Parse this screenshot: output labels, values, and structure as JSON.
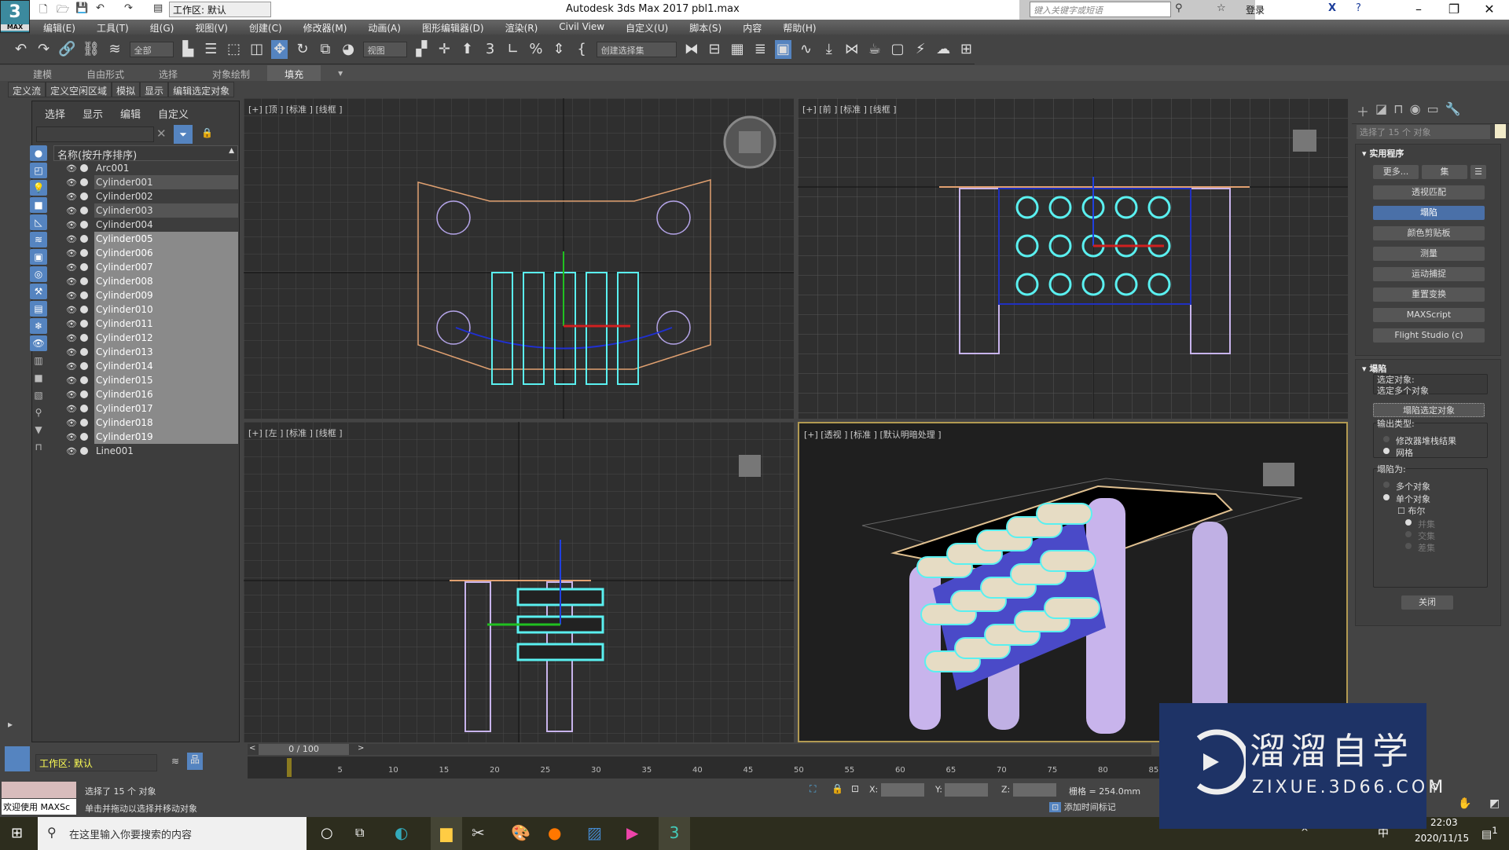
{
  "titlebar": {
    "logo": "3",
    "logo_sub": "MAX",
    "workspace": "工作区: 默认",
    "app_title": "Autodesk 3ds Max 2017",
    "file": "pbl1.max",
    "search_placeholder": "键入关键字或短语",
    "login": "登录"
  },
  "menu": [
    "编辑(E)",
    "工具(T)",
    "组(G)",
    "视图(V)",
    "创建(C)",
    "修改器(M)",
    "动画(A)",
    "图形编辑器(D)",
    "渲染(R)",
    "Civil View",
    "自定义(U)",
    "脚本(S)",
    "内容",
    "帮助(H)"
  ],
  "toolbar": {
    "filter": "全部",
    "ref_coord": "视图",
    "selection_set": "创建选择集"
  },
  "ribbon": {
    "tabs": [
      "建模",
      "自由形式",
      "选择",
      "对象绘制",
      "填充"
    ],
    "active": "填充",
    "subtabs": [
      "定义流",
      "定义空闲区域",
      "模拟",
      "显示",
      "编辑选定对象"
    ]
  },
  "explorer": {
    "menu": [
      "选择",
      "显示",
      "编辑",
      "自定义"
    ],
    "column_header": "名称(按升序排序)",
    "rows": [
      {
        "name": "Arc001",
        "state": "none"
      },
      {
        "name": "Cylinder001",
        "state": "part"
      },
      {
        "name": "Cylinder002",
        "state": "none"
      },
      {
        "name": "Cylinder003",
        "state": "part"
      },
      {
        "name": "Cylinder004",
        "state": "none"
      },
      {
        "name": "Cylinder005",
        "state": "sel"
      },
      {
        "name": "Cylinder006",
        "state": "sel"
      },
      {
        "name": "Cylinder007",
        "state": "sel"
      },
      {
        "name": "Cylinder008",
        "state": "sel"
      },
      {
        "name": "Cylinder009",
        "state": "sel"
      },
      {
        "name": "Cylinder010",
        "state": "sel"
      },
      {
        "name": "Cylinder011",
        "state": "sel"
      },
      {
        "name": "Cylinder012",
        "state": "sel"
      },
      {
        "name": "Cylinder013",
        "state": "sel"
      },
      {
        "name": "Cylinder014",
        "state": "sel"
      },
      {
        "name": "Cylinder015",
        "state": "sel"
      },
      {
        "name": "Cylinder016",
        "state": "sel"
      },
      {
        "name": "Cylinder017",
        "state": "sel"
      },
      {
        "name": "Cylinder018",
        "state": "sel"
      },
      {
        "name": "Cylinder019",
        "state": "sel"
      },
      {
        "name": "Line001",
        "state": "none"
      }
    ],
    "workspace": "工作区: 默认"
  },
  "viewports": {
    "top": "[+] [顶 ] [标准 ] [线框 ]",
    "front": "[+] [前 ] [标准 ] [线框 ]",
    "left": "[+] [左 ] [标准 ] [线框 ]",
    "persp": "[+] [透视 ] [标准 ] [默认明暗处理 ]"
  },
  "command_panel": {
    "selection": "选择了 15 个 对象",
    "utilities_title": "实用程序",
    "more": "更多...",
    "sets": "集",
    "utilities": [
      "透视匹配",
      "塌陷",
      "颜色剪贴板",
      "测量",
      "运动捕捉",
      "重置变换",
      "MAXScript",
      "Flight Studio (c)"
    ],
    "active_utility": "塌陷",
    "collapse_title": "塌陷",
    "selected_label": "选定对象:",
    "selected_value": "选定多个对象",
    "collapse_btn": "塌陷选定对象",
    "output_label": "输出类型:",
    "output_options": [
      "修改器堆栈结果",
      "网格"
    ],
    "output_selected": "网格",
    "collapse_as_label": "塌陷为:",
    "collapse_as_options": [
      "多个对象",
      "单个对象"
    ],
    "collapse_as_selected": "单个对象",
    "boolean": "布尔",
    "boolean_ops": [
      "并集",
      "交集",
      "差集"
    ],
    "close": "关闭"
  },
  "timeline": {
    "slider": "0 / 100",
    "ticks": [
      "0",
      "5",
      "10",
      "15",
      "20",
      "25",
      "30",
      "35",
      "40",
      "45",
      "50",
      "55",
      "60",
      "65",
      "70",
      "75",
      "80",
      "85"
    ]
  },
  "status": {
    "maxscript": "欢迎使用 MAXSc",
    "selected": "选择了 15 个 对象",
    "hint": "单击并拖动以选择并移动对象",
    "x": "X:",
    "y": "Y:",
    "z": "Z:",
    "grid": "栅格 = 254.0mm",
    "add_time_tag": "添加时间标记"
  },
  "taskbar": {
    "search": "在这里输入你要搜索的内容",
    "time": "22:03",
    "date": "2020/11/15",
    "ime": "中",
    "notifications": "1"
  },
  "watermark": {
    "brand": "溜溜自学",
    "url": "ZIXUE.3D66.COM"
  },
  "colors": {
    "selection": "#5af0f0",
    "accent": "#5584c0",
    "object": "#c8b4ec"
  }
}
